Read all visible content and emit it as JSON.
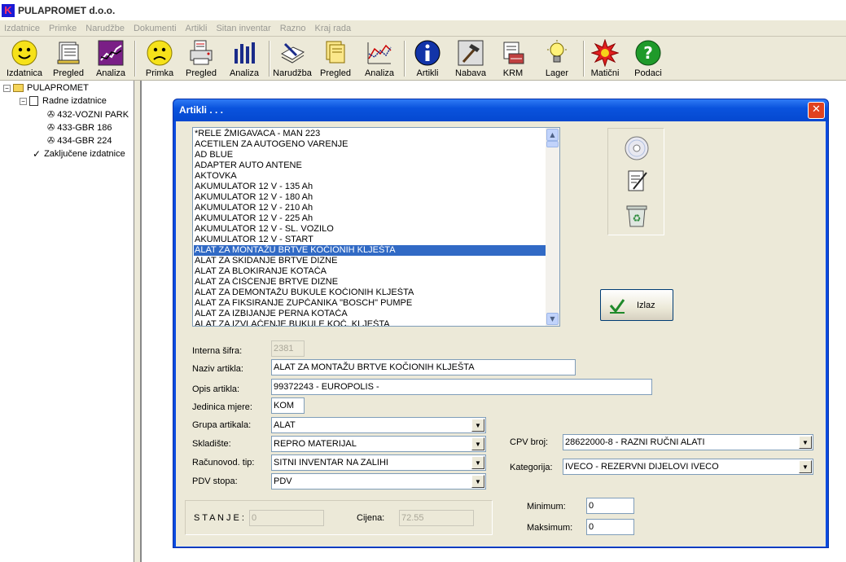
{
  "app": {
    "title": "PULAPROMET d.o.o.",
    "logo_letter": "K"
  },
  "menu": [
    "Izdatnice",
    "Primke",
    "Narudžbe",
    "Dokumenti",
    "Artikli",
    "Sitan inventar",
    "Razno",
    "Kraj rada"
  ],
  "toolbar": {
    "izdatnica": "Izdatnica",
    "pregled1": "Pregled",
    "analiza1": "Analiza",
    "primka": "Primka",
    "pregled2": "Pregled",
    "analiza2": "Analiza",
    "narudzba": "Narudžba",
    "pregled3": "Pregled",
    "analiza3": "Analiza",
    "artikli": "Artikli",
    "nabava": "Nabava",
    "krm": "KRM",
    "lager": "Lager",
    "maticni": "Matični",
    "podaci": "Podaci"
  },
  "tree": {
    "root": "PULAPROMET",
    "radne": "Radne izdatnice",
    "items": [
      "432-VOZNI PARK",
      "433-GBR 186",
      "434-GBR 224"
    ],
    "zakljucene": "Zaključene izdatnice"
  },
  "dialog": {
    "title": "Artikli . . .",
    "close": "✕",
    "list": [
      "*RELE ŽMIGAVACA - MAN 223",
      "ACETILEN ZA AUTOGENO VARENJE",
      "AD BLUE",
      "ADAPTER AUTO ANTENE",
      "AKTOVKA",
      "AKUMULATOR 12 V - 135 Ah",
      "AKUMULATOR 12 V - 180 Ah",
      "AKUMULATOR 12 V - 210 Ah",
      "AKUMULATOR 12 V - 225 Ah",
      "AKUMULATOR 12 V - SL. VOZILO",
      "AKUMULATOR 12 V - START",
      "ALAT ZA  MONTAŽU BRTVE KOČIONIH KLJEŠTA",
      "ALAT ZA  SKIDANJE BRTVE DIZNE",
      "ALAT ZA BLOKIRANJE KOTAČA",
      "ALAT ZA ČIŠĆENJE BRTVE DIZNE",
      "ALAT ZA DEMONTAŽU BUKULE KOČIONIH KLJEŠTA",
      "ALAT ZA FIKSIRANJE ZUPČANIKA \"BOSCH\" PUMPE",
      "ALAT ZA IZBIJANJE PERNA KOTAČA",
      "ALAT ZA IZVLAČENJE BUKULE KOČ. KLJEŠTA"
    ],
    "selected_index": 11,
    "izlaz_label": "Izlaz",
    "labels": {
      "interna": "Interna šifra:",
      "naziv": "Naziv artikla:",
      "opis": "Opis artikla:",
      "jedinica": "Jedinica mjere:",
      "grupa": "Grupa artikala:",
      "skladiste": "Skladište:",
      "racunovod": "Računovod. tip:",
      "pdv": "PDV stopa:",
      "cpv": "CPV broj:",
      "kategorija": "Kategorija:",
      "stanje": "S T A N J E :",
      "cijena": "Cijena:",
      "minimum": "Minimum:",
      "maksimum": "Maksimum:"
    },
    "values": {
      "interna": "2381",
      "naziv": "ALAT ZA  MONTAŽU BRTVE KOČIONIH KLJEŠTA",
      "opis": "99372243 - EUROPOLIS -",
      "jedinica": "KOM",
      "grupa": "ALAT",
      "skladiste": "REPRO MATERIJAL",
      "racunovod": "SITNI INVENTAR NA ZALIHI",
      "pdv": "PDV",
      "cpv": "28622000-8  -  RAZNI RUČNI ALATI",
      "kategorija": "IVECO  -  REZERVNI DIJELOVI IVECO",
      "stanje": "0",
      "cijena": "72.55",
      "minimum": "0",
      "maksimum": "0"
    }
  },
  "colors": {
    "selection": "#316ac5",
    "titlebar": "#0a53dd",
    "desktop": "#ece9d8"
  }
}
